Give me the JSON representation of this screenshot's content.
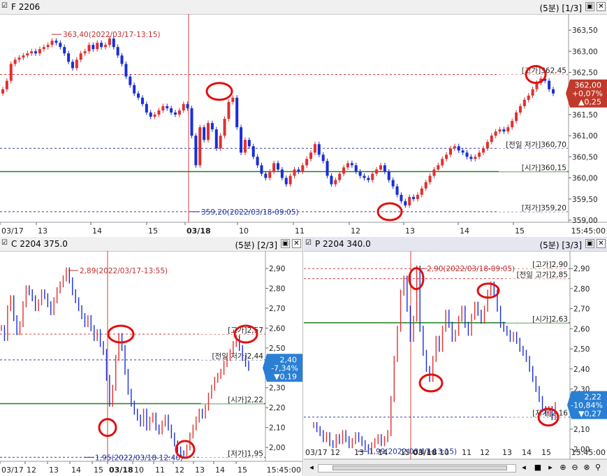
{
  "panels": {
    "f": {
      "title": "F 2206",
      "period": "(5분) [1/3]",
      "price_box": {
        "price": "362,00",
        "pct": "+0,07%",
        "chg": "▲0,25",
        "color": "#c0392b"
      },
      "chart_data": {
        "type": "candlestick",
        "ylim": [
          358.95,
          363.75
        ],
        "yticks": [
          "363,50",
          "363,00",
          "362,50",
          "362,00",
          "361,50",
          "361,00",
          "360,50",
          "360,00",
          "359,50",
          "359,00"
        ],
        "yticks_values": [
          363.5,
          363.0,
          362.5,
          362.0,
          361.5,
          361.0,
          360.5,
          360.0,
          359.5,
          359.0
        ],
        "xticks": [
          "03/17",
          "13",
          "14",
          "15",
          "03/18",
          "10",
          "11",
          "12",
          "13",
          "14",
          "15"
        ],
        "time_label": "15:45:00",
        "series_close": [
          362.1,
          362.3,
          362.7,
          362.8,
          362.85,
          362.9,
          362.95,
          363.0,
          362.95,
          363.05,
          363.1,
          363.15,
          363.25,
          363.2,
          363.1,
          362.95,
          362.75,
          362.6,
          362.8,
          362.95,
          363.0,
          363.15,
          363.05,
          363.2,
          363.1,
          363.15,
          363.3,
          363.1,
          362.9,
          362.7,
          362.4,
          362.2,
          362.0,
          361.9,
          361.75,
          361.55,
          361.45,
          361.5,
          361.6,
          361.7,
          361.65,
          361.55,
          361.5,
          361.6,
          361.75,
          361.65,
          361.0,
          360.3,
          361.2,
          360.9,
          361.3,
          361.15,
          360.7,
          361.0,
          361.4,
          361.8,
          361.9,
          361.2,
          360.6,
          360.9,
          360.75,
          360.5,
          360.3,
          360.1,
          360.0,
          360.15,
          360.35,
          360.2,
          360.0,
          359.85,
          360.05,
          360.2,
          360.15,
          360.3,
          360.45,
          360.6,
          360.8,
          360.55,
          360.4,
          360.05,
          359.85,
          359.95,
          360.1,
          360.25,
          360.35,
          360.3,
          360.15,
          360.05,
          360.0,
          359.95,
          360.1,
          360.2,
          360.3,
          360.15,
          359.95,
          359.8,
          359.6,
          359.45,
          359.35,
          359.55,
          359.5,
          359.6,
          359.75,
          359.9,
          360.05,
          360.2,
          360.3,
          360.45,
          360.55,
          360.7,
          360.75,
          360.65,
          360.6,
          360.5,
          360.45,
          360.5,
          360.6,
          360.7,
          360.85,
          361.0,
          361.1,
          361.15,
          361.1,
          361.2,
          361.35,
          361.55,
          361.7,
          361.85,
          361.95,
          362.1,
          362.25,
          362.35,
          362.3,
          362.1,
          362.0
        ],
        "series_open": [
          362.0,
          362.1,
          362.3,
          362.7,
          362.8,
          362.85,
          362.9,
          362.95,
          363.0,
          362.95,
          363.05,
          363.1,
          363.15,
          363.25,
          363.2,
          363.1,
          362.95,
          362.75,
          362.6,
          362.8,
          362.95,
          363.0,
          363.15,
          363.05,
          363.2,
          363.1,
          363.15,
          363.3,
          363.1,
          362.9,
          362.7,
          362.4,
          362.2,
          362.0,
          361.9,
          361.75,
          361.55,
          361.45,
          361.5,
          361.6,
          361.7,
          361.65,
          361.55,
          361.5,
          361.6,
          361.75,
          361.65,
          361.0,
          360.3,
          361.2,
          360.9,
          361.3,
          361.15,
          360.7,
          361.0,
          361.4,
          361.8,
          361.9,
          361.2,
          360.6,
          360.9,
          360.75,
          360.5,
          360.3,
          360.1,
          360.0,
          360.15,
          360.35,
          360.2,
          360.0,
          359.85,
          360.05,
          360.2,
          360.15,
          360.3,
          360.45,
          360.6,
          360.8,
          360.55,
          360.4,
          360.05,
          359.85,
          359.95,
          360.1,
          360.25,
          360.35,
          360.3,
          360.15,
          360.05,
          360.0,
          359.95,
          360.1,
          360.2,
          360.3,
          360.15,
          359.95,
          359.8,
          359.6,
          359.45,
          359.35,
          359.55,
          359.5,
          359.6,
          359.75,
          359.9,
          360.05,
          360.2,
          360.3,
          360.45,
          360.55,
          360.7,
          360.75,
          360.65,
          360.6,
          360.5,
          360.45,
          360.5,
          360.6,
          360.7,
          360.85,
          361.0,
          361.1,
          361.15,
          361.1,
          361.2,
          361.35,
          361.55,
          361.7,
          361.85,
          361.95,
          362.1,
          362.25,
          362.35,
          362.3,
          362.1
        ],
        "hlines": [
          {
            "label": "[고가]362,45",
            "value": 362.45,
            "color": "#d04040",
            "style": "dash"
          },
          {
            "label": "[전일 저가]360,70",
            "value": 360.7,
            "color": "#3040a0",
            "style": "dash"
          },
          {
            "label": "[시가]360,15",
            "value": 360.15,
            "color": "#208020",
            "style": "solid"
          },
          {
            "label": "[저가]359,20",
            "value": 359.2,
            "color": "#3040a0",
            "style": "dash"
          }
        ],
        "annotations": [
          {
            "text": "363,40(2022/03/17-13:15)",
            "value": 363.4,
            "color": "#c03030"
          },
          {
            "text": "359,20(2022/03/18-09:05)",
            "value": 359.2,
            "color": "#2030a0"
          }
        ]
      }
    },
    "c": {
      "title": "C 2204 375.0",
      "period": "(5분) [2/3]",
      "price_box": {
        "price": "2,40",
        "pct": "-7,34%",
        "chg": "▼0,19",
        "color": "#2a7fd4"
      },
      "chart_data": {
        "type": "line",
        "ylim": [
          1.93,
          2.96
        ],
        "yticks": [
          "2,90",
          "2,80",
          "2,70",
          "2,60",
          "2,50",
          "2,40",
          "2,30",
          "2,20",
          "2,10",
          "2,00"
        ],
        "yticks_values": [
          2.9,
          2.8,
          2.7,
          2.6,
          2.5,
          2.4,
          2.3,
          2.2,
          2.1,
          2.0
        ],
        "xticks": [
          "03/17",
          "12",
          "13",
          "14",
          "15",
          "03/18",
          "10",
          "11",
          "12",
          "13",
          "14",
          "15"
        ],
        "time_label": "15:45:00",
        "series": [
          {
            "values": [
              2.6,
              2.55,
              2.7,
              2.75,
              2.65,
              2.58,
              2.62,
              2.72,
              2.8,
              2.78,
              2.75,
              2.7,
              2.73,
              2.78,
              2.76,
              2.72,
              2.68,
              2.74,
              2.79,
              2.82,
              2.85,
              2.89,
              2.84,
              2.78,
              2.74,
              2.7,
              2.66,
              2.62,
              2.65,
              2.6,
              2.55,
              2.58,
              2.52,
              2.48,
              2.35,
              2.22,
              2.3,
              2.45,
              2.56,
              2.5,
              2.38,
              2.28,
              2.22,
              2.18,
              2.15,
              2.12,
              2.18,
              2.1,
              2.14,
              2.16,
              2.1,
              2.08,
              2.12,
              2.15,
              2.1,
              2.06,
              2.02,
              1.99,
              1.97,
              1.96,
              2.0,
              2.06,
              2.1,
              2.14,
              2.18,
              2.16,
              2.2,
              2.26,
              2.3,
              2.34,
              2.36,
              2.38,
              2.42,
              2.45,
              2.48,
              2.52,
              2.55,
              2.5,
              2.45,
              2.42,
              2.4
            ]
          }
        ],
        "hlines": [
          {
            "label": "[고가]2,57",
            "value": 2.57,
            "color": "#d04040",
            "style": "dash"
          },
          {
            "label": "[전일 저가]2,44",
            "value": 2.44,
            "color": "#3040a0",
            "style": "dash"
          },
          {
            "label": "[시가]2,22",
            "value": 2.22,
            "color": "#208020",
            "style": "solid"
          },
          {
            "label": "[저가]1,95",
            "value": 1.95,
            "color": "#3040a0",
            "style": "dash"
          }
        ],
        "annotations": [
          {
            "text": "2,89(2022/03/17-13:55)",
            "value": 2.89,
            "color": "#c03030"
          },
          {
            "text": "1,95(2022/03/18-12:40)",
            "value": 1.95,
            "color": "#2030a0"
          }
        ]
      }
    },
    "p": {
      "title": "P 2204 340.0",
      "period": "(5분) [3/3]",
      "price_box": {
        "price": "2,22",
        "pct": "-10,84%",
        "chg": "▼0,27",
        "color": "#2a7fd4"
      },
      "chart_data": {
        "type": "line",
        "ylim": [
          1.95,
          2.96
        ],
        "yticks": [
          "2,90",
          "2,80",
          "2,70",
          "2,60",
          "2,50",
          "2,40",
          "2,30",
          "2,20",
          "2,10",
          "2,00"
        ],
        "yticks_values": [
          2.9,
          2.8,
          2.7,
          2.6,
          2.5,
          2.4,
          2.3,
          2.2,
          2.1,
          2.0
        ],
        "xticks": [
          "03/17",
          "12",
          "13",
          "14",
          "15",
          "03/18",
          "10",
          "11",
          "12",
          "13",
          "14",
          "15"
        ],
        "time_label": "15:45:00",
        "series": [
          {
            "values": [
              2.12,
              2.1,
              2.08,
              2.05,
              2.07,
              2.03,
              2.02,
              2.06,
              2.04,
              2.08,
              2.05,
              2.02,
              2.04,
              2.07,
              2.05,
              2.03,
              2.01,
              1.99,
              2.02,
              2.04,
              2.06,
              2.03,
              2.05,
              2.08,
              2.25,
              2.45,
              2.6,
              2.78,
              2.85,
              2.7,
              2.55,
              2.65,
              2.9,
              2.6,
              2.48,
              2.4,
              2.35,
              2.45,
              2.55,
              2.5,
              2.6,
              2.68,
              2.62,
              2.55,
              2.58,
              2.65,
              2.7,
              2.62,
              2.58,
              2.66,
              2.72,
              2.68,
              2.64,
              2.7,
              2.78,
              2.82,
              2.78,
              2.7,
              2.62,
              2.6,
              2.58,
              2.55,
              2.57,
              2.54,
              2.5,
              2.48,
              2.45,
              2.4,
              2.35,
              2.3,
              2.25,
              2.2,
              2.18,
              2.2,
              2.16,
              2.22
            ]
          }
        ],
        "hlines": [
          {
            "label": "[고가]2,90",
            "value": 2.9,
            "color": "#d04040",
            "style": "dash"
          },
          {
            "label": "[전일 고가]2,85",
            "value": 2.85,
            "color": "#d04040",
            "style": "dash"
          },
          {
            "label": "[시가]2,63",
            "value": 2.63,
            "color": "#208020",
            "style": "solid"
          },
          {
            "label": "[저가]2,16",
            "value": 2.16,
            "color": "#3040a0",
            "style": "dash"
          }
        ],
        "annotations": [
          {
            "text": "2,90(2022/03/18-09:05)",
            "value": 2.9,
            "color": "#c03030"
          },
          {
            "text": "1,99(2022/03/17-13:15)",
            "value": 1.99,
            "color": "#2030a0"
          }
        ]
      }
    }
  },
  "colors": {
    "up": "#e03030",
    "down": "#1a2ed6",
    "circle": "#e01010",
    "session_line": "#d04040"
  },
  "toolbar": {
    "icons": [
      "scroll-left-icon",
      "scroll-right-icon",
      "stop-icon",
      "zoom-in-icon",
      "zoom-out-icon",
      "zoom-reset-icon",
      "search-icon"
    ]
  }
}
